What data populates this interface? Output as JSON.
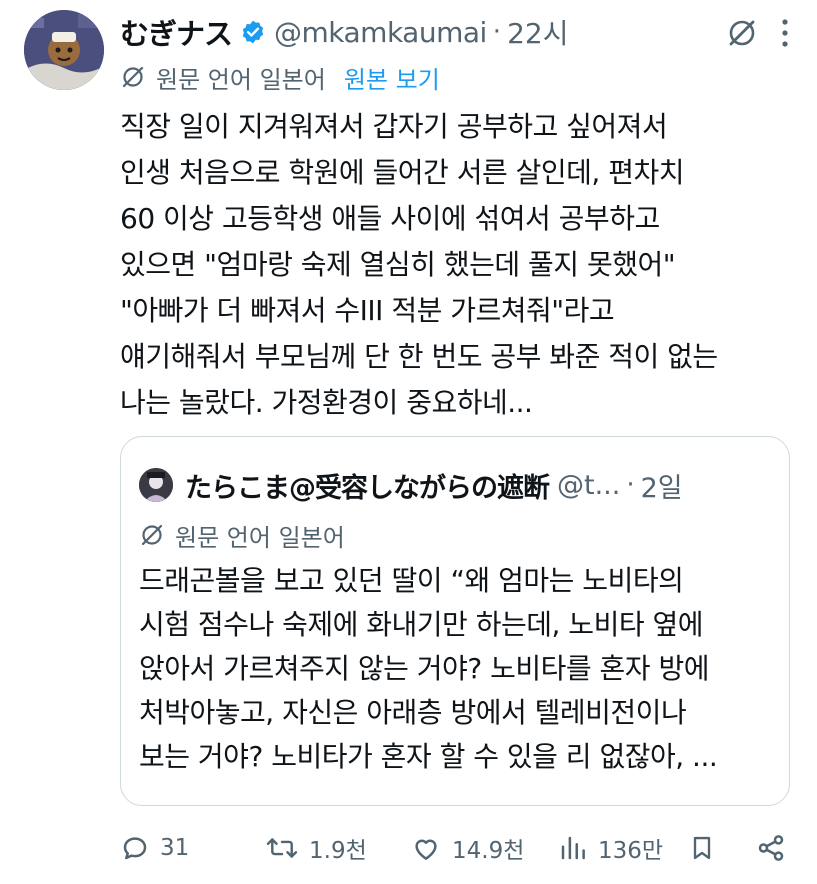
{
  "tweet": {
    "display_name": "むぎナス",
    "handle": "@mkamkaumai",
    "separator": "·",
    "time": "22시",
    "language_label": "원문 언어 일본어",
    "show_original": "원본 보기",
    "text_lines": [
      "직장 일이 지겨워져서 갑자기 공부하고 싶어져서",
      "인생 처음으로 학원에 들어간 서른 살인데, 편차치",
      "60 이상 고등학생 애들 사이에 섞여서 공부하고",
      "있으면 \"엄마랑 숙제 열심히 했는데 풀지 못했어\"",
      "\"아빠가 더 빠져서 수III 적분 가르쳐줘\"라고",
      "얘기해줘서 부모님께 단 한 번도 공부 봐준 적이 없는",
      "나는 놀랐다. 가정환경이 중요하네..."
    ]
  },
  "quote": {
    "display_name": "たらこま@受容しながらの遮断",
    "handle": "@t...",
    "separator": "·",
    "time": "2일",
    "language_label": "원문 언어 일본어",
    "text_lines": [
      "드래곤볼을 보고 있던 딸이 “왜 엄마는 노비타의",
      "시험 점수나 숙제에 화내기만 하는데, 노비타 옆에",
      "앉아서 가르쳐주지 않는 거야? 노비타를 혼자 방에",
      "처박아놓고, 자신은 아래층 방에서 텔레비전이나",
      "보는 거야? 노비타가 혼자 할 수 있을 리 없잖아, ..."
    ]
  },
  "actions": {
    "replies": "31",
    "reposts": "1.9천",
    "likes": "14.9천",
    "views": "136만"
  },
  "icons": {
    "verified": "verified-badge-icon",
    "grok": "grok-icon",
    "more": "more-dots-icon",
    "translate": "translate-icon",
    "reply": "reply-icon",
    "repost": "repost-icon",
    "like": "heart-icon",
    "views": "views-bar-icon",
    "bookmark": "bookmark-icon",
    "share": "share-icon"
  },
  "colors": {
    "accent": "#1d9bf0",
    "muted": "#536471",
    "text": "#0f1419",
    "border": "#cfd9de"
  }
}
